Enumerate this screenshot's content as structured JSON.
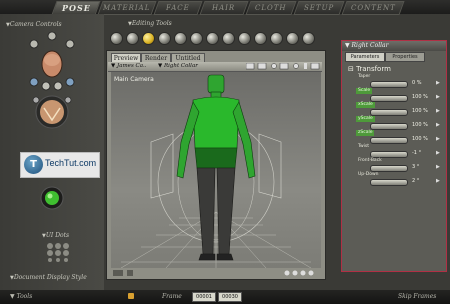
{
  "tabs": [
    {
      "label": "POSE",
      "active": true
    },
    {
      "label": "MATERIAL",
      "active": false
    },
    {
      "label": "FACE",
      "active": false
    },
    {
      "label": "HAIR",
      "active": false
    },
    {
      "label": "CLOTH",
      "active": false
    },
    {
      "label": "SETUP",
      "active": false
    },
    {
      "label": "CONTENT",
      "active": false
    }
  ],
  "left": {
    "camera_controls": "Camera Controls",
    "ui_dots": "UI Dots",
    "doc_display_style": "Document Display Style"
  },
  "tools": {
    "title": "Editing Tools"
  },
  "viewport": {
    "tabs": [
      "Preview",
      "Render",
      "Untitled"
    ],
    "figure_menu": "James Ca..",
    "part_menu": "Right Collar",
    "camera_label": "Main Camera"
  },
  "params_panel": {
    "title": "Right Collar",
    "tabs": [
      "Parameters",
      "Properties"
    ],
    "group": "Transform",
    "params": [
      {
        "name": "Taper",
        "value": "0 %",
        "highlight": false
      },
      {
        "name": "Scale",
        "value": "100 %",
        "highlight": true
      },
      {
        "name": "xScale",
        "value": "100 %",
        "highlight": true
      },
      {
        "name": "yScale",
        "value": "100 %",
        "highlight": true
      },
      {
        "name": "zScale",
        "value": "100 %",
        "highlight": true
      },
      {
        "name": "Twist",
        "value": "-1 °",
        "highlight": false
      },
      {
        "name": "Front-Back",
        "value": "3 °",
        "highlight": false
      },
      {
        "name": "Up-Down",
        "value": "2 °",
        "highlight": false
      }
    ]
  },
  "bottom": {
    "left_label": "Tools",
    "frame_label": "Frame",
    "frame_current": "00001",
    "frame_total": "00030",
    "right_label": "Skip Frames"
  },
  "watermark": {
    "letter": "T",
    "text": "TechTut.com"
  },
  "colors": {
    "accent_green": "#3fbf30",
    "panel_border": "#b03045"
  }
}
